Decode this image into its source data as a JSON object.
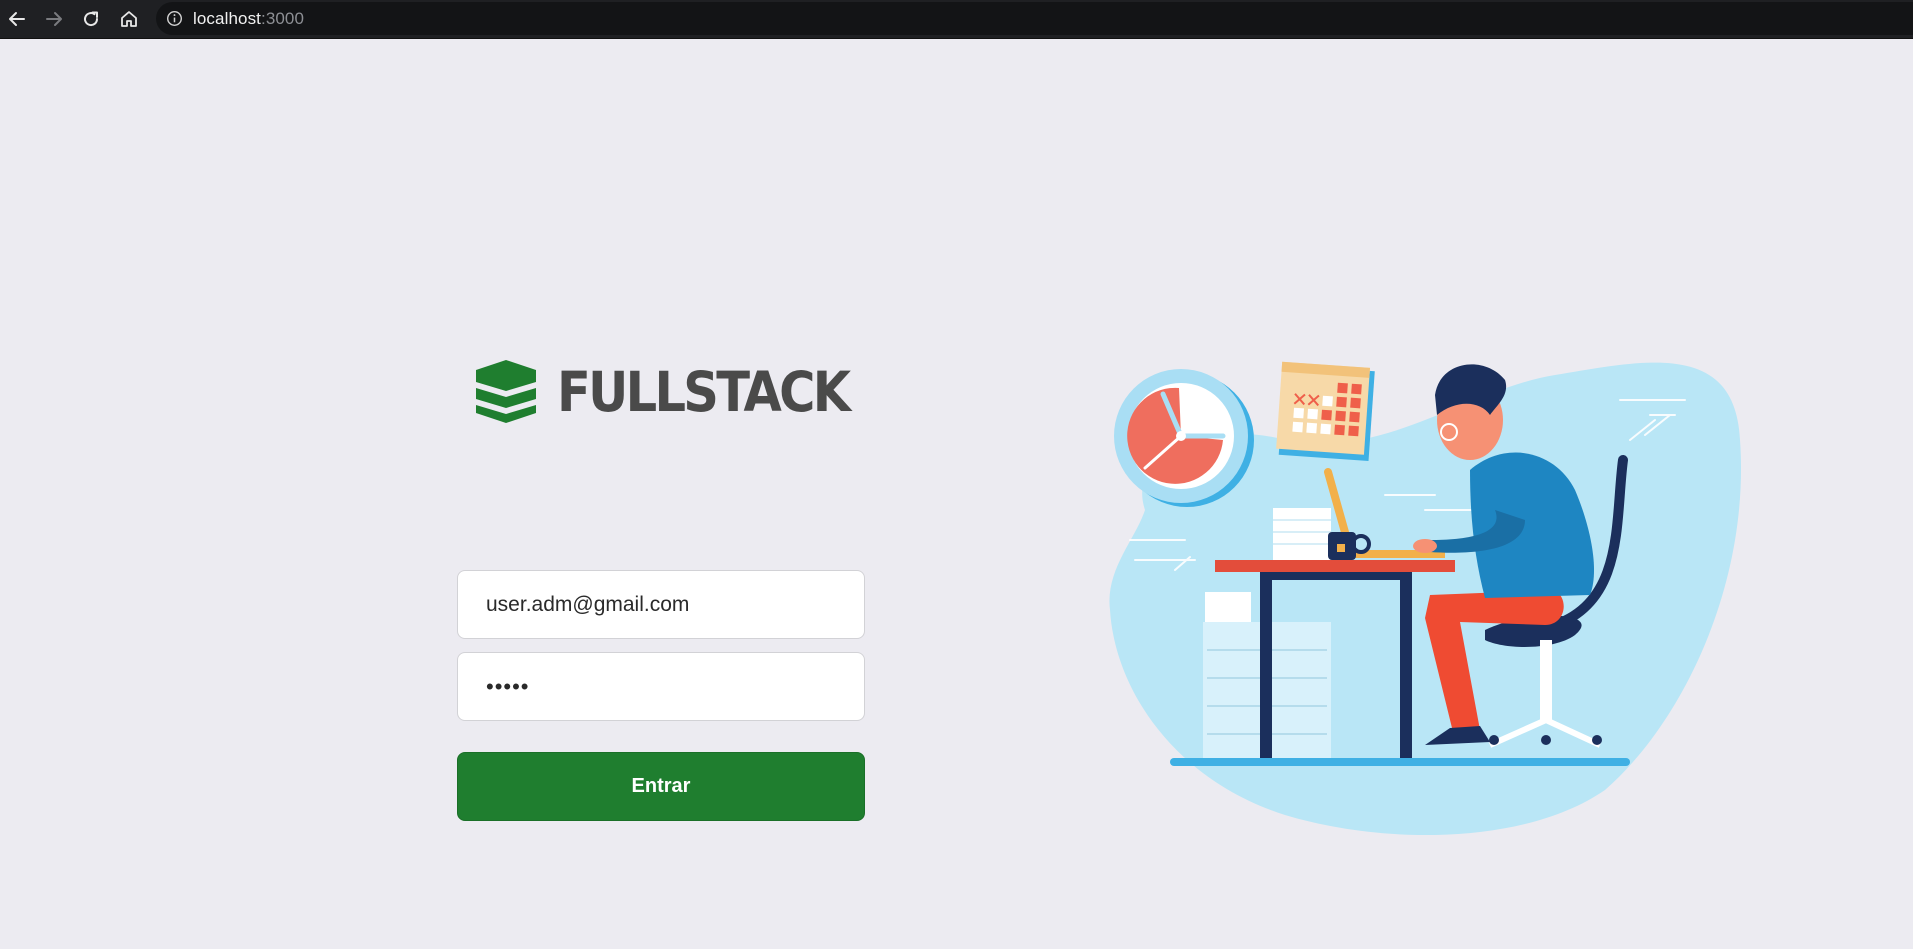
{
  "browser": {
    "url_host": "localhost",
    "url_port": ":3000",
    "icons": [
      "back-icon",
      "forward-icon",
      "reload-icon",
      "home-icon",
      "info-icon"
    ]
  },
  "brand": {
    "name": "FULLSTACK",
    "logo_icon": "stacked-layers-icon",
    "logo_color": "#1f7e2f"
  },
  "login": {
    "email_value": "user.adm@gmail.com",
    "password_value": "•••••",
    "submit_label": "Entrar",
    "submit_color": "#1f7e2f"
  },
  "illustration": {
    "description_icon": "person-working-at-desk-illustration",
    "blob_color": "#b9e6f6",
    "accent_color": "#ef5f4a"
  }
}
